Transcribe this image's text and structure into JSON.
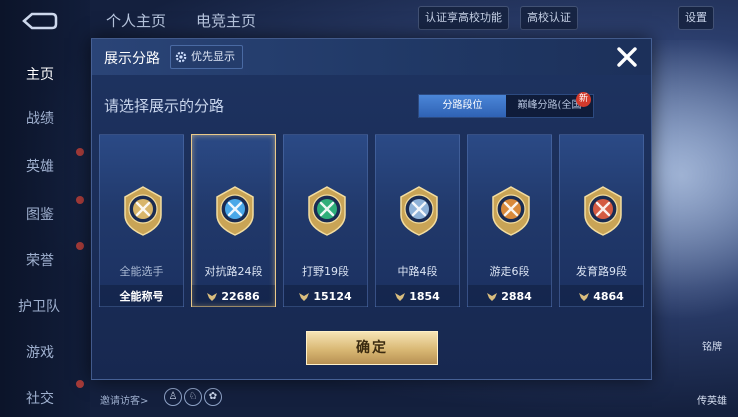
{
  "top": {
    "tabs": [
      "个人主页",
      "电竞主页"
    ],
    "auth_tip": "认证享高校功能",
    "campus_auth": "高校认证",
    "settings": "设置"
  },
  "leftnav": {
    "items": [
      "主页",
      "战绩",
      "英雄",
      "图鉴",
      "荣誉",
      "护卫队",
      "游戏",
      "社交"
    ]
  },
  "modal": {
    "title": "展示分路",
    "priority_button": "优先显示",
    "subtitle": "请选择展示的分路",
    "toggle": [
      "分路段位",
      "巅峰分路(全国"
    ],
    "new_badge": "新",
    "confirm": "确定",
    "cards": [
      {
        "name": "全能选手",
        "stat": "全能称号",
        "badge": "all-round-badge-icon",
        "color": "#d8b56a"
      },
      {
        "name": "对抗路24段",
        "stat": "22686",
        "badge": "clash-lane-badge-icon",
        "color": "#4aa8e8"
      },
      {
        "name": "打野19段",
        "stat": "15124",
        "badge": "jungle-badge-icon",
        "color": "#2fae7a"
      },
      {
        "name": "中路4段",
        "stat": "1854",
        "badge": "mid-lane-badge-icon",
        "color": "#8fb2d8"
      },
      {
        "name": "游走6段",
        "stat": "2884",
        "badge": "roam-badge-icon",
        "color": "#d9893a"
      },
      {
        "name": "发育路9段",
        "stat": "4864",
        "badge": "farm-lane-badge-icon",
        "color": "#d45a42"
      }
    ]
  },
  "bottom": {
    "hint": "邀请访客>",
    "right_labels": [
      "铭牌",
      "传英雄"
    ]
  },
  "colors": {
    "accent_gold": "#e9c98a",
    "toggle_active": "#3a73c6",
    "modal_bg": "#1e3361"
  }
}
